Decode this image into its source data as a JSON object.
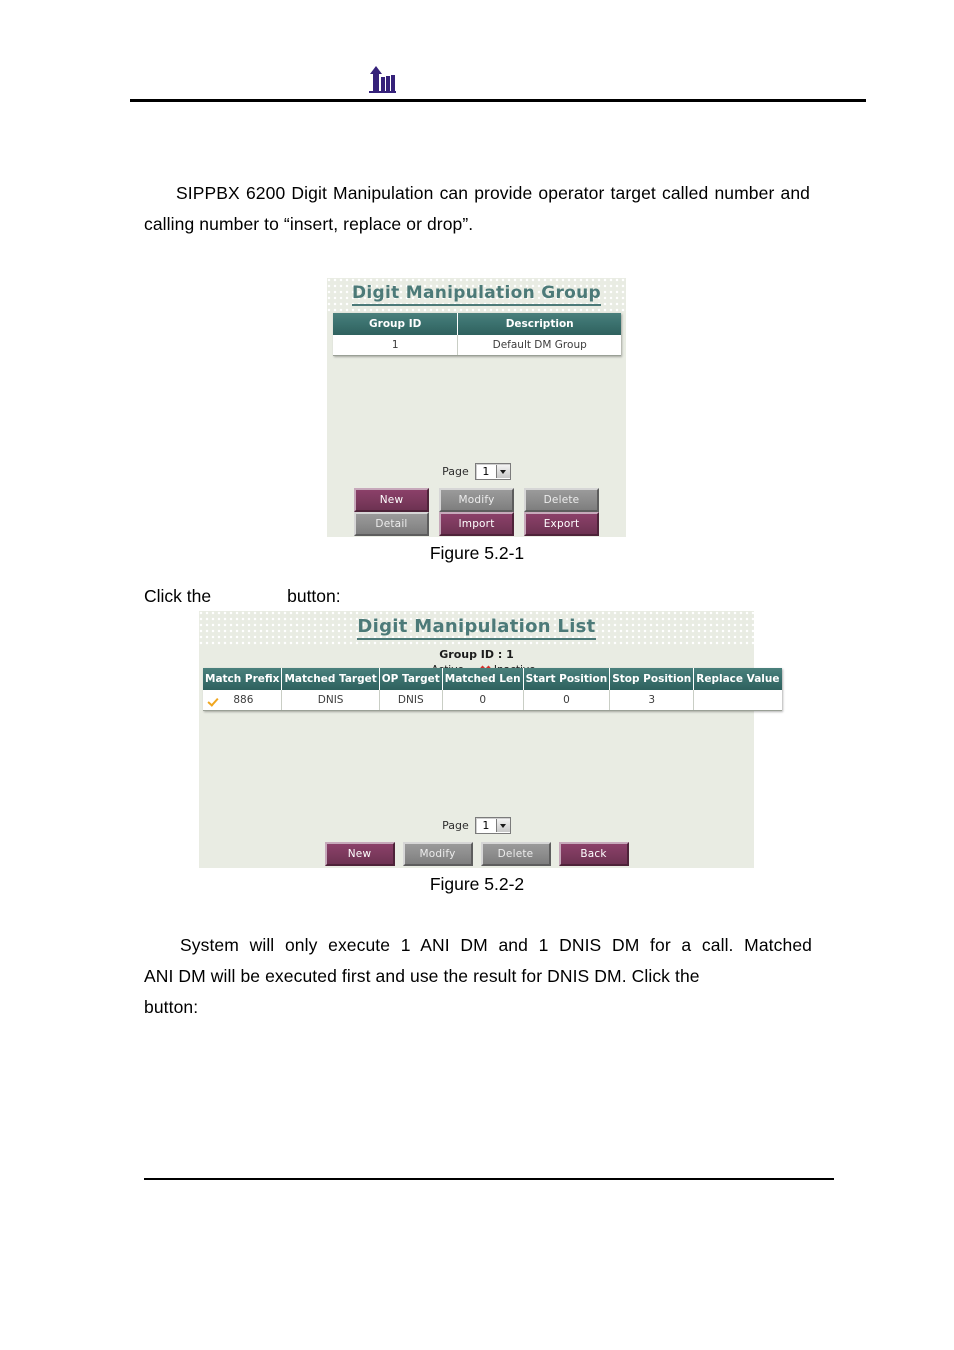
{
  "document": {
    "header": {
      "logo_icon": "arrow-building-logo"
    },
    "paragraph_1": "SIPPBX 6200 Digit Manipulation can provide operator target called number and calling number to “insert, replace or drop”.",
    "click_line": {
      "before": "Click the",
      "after": "button:"
    },
    "paragraph_2": {
      "line1": "System will only execute 1 ANI DM and 1 DNIS DM for a call. Matched",
      "line2": "ANI DM will be executed first and use the result for DNIS DM. Click the",
      "line3": "button:"
    },
    "caption_1": "Figure 5.2-1",
    "caption_2": "Figure 5.2-2"
  },
  "figure1": {
    "title": "Digit Manipulation Group",
    "table": {
      "headers": [
        "Group ID",
        "Description"
      ],
      "rows": [
        [
          "1",
          "Default DM Group"
        ]
      ]
    },
    "page_label": "Page",
    "page_value": "1",
    "buttons": [
      {
        "label": "New",
        "style": "purple"
      },
      {
        "label": "Modify",
        "style": "gray"
      },
      {
        "label": "Delete",
        "style": "gray"
      },
      {
        "label": "Detail",
        "style": "gray"
      },
      {
        "label": "Import",
        "style": "purple"
      },
      {
        "label": "Export",
        "style": "purple"
      }
    ]
  },
  "figure2": {
    "title": "Digit Manipulation List",
    "group_id": "Group ID : 1",
    "legend": [
      {
        "icon": "check-icon",
        "label": "Active"
      },
      {
        "icon": "x-icon",
        "label": "Inactive"
      }
    ],
    "table": {
      "headers": [
        "Match Prefix",
        "Matched Target",
        "OP Target",
        "Matched Len",
        "Start Position",
        "Stop Position",
        "Replace Value"
      ],
      "rows": [
        {
          "status": "active",
          "match_prefix": "886",
          "matched_target": "DNIS",
          "op_target": "DNIS",
          "matched_len": "0",
          "start_position": "0",
          "stop_position": "3",
          "replace_value": ""
        }
      ]
    },
    "page_label": "Page",
    "page_value": "1",
    "buttons": [
      {
        "label": "New",
        "style": "purple"
      },
      {
        "label": "Modify",
        "style": "gray"
      },
      {
        "label": "Delete",
        "style": "gray"
      },
      {
        "label": "Back",
        "style": "purple"
      }
    ]
  },
  "colors": {
    "panel_bg": "#e9ece3",
    "table_header_teal": "#3c7370",
    "title_teal": "#4c7a78",
    "button_purple": "#7d3a5e",
    "button_gray": "#8d8d8d",
    "logo_purple": "#35217a"
  }
}
